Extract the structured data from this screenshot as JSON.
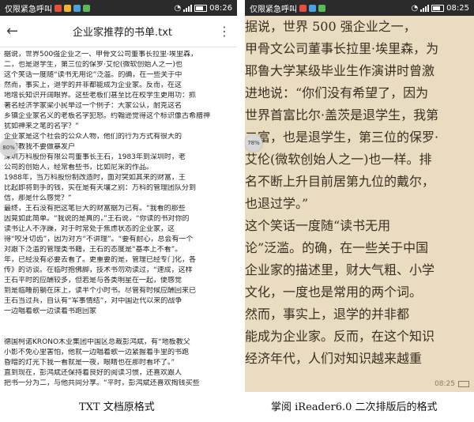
{
  "left": {
    "status": {
      "carrier": "仅限紧急呼叫",
      "time": "08:26"
    },
    "title": "企业家推荐的书单.txt",
    "progress": "80%",
    "lines": [
      "据说，世界500强企业之一、甲骨文公司董事长拉里·埃里森，",
      "二，也是退学生，第三位的保罗·艾伦(微软创始人之一)也",
      "    这个笑话一度随“读书无用论”泛滥。的确，在一些关于中",
      "    然而，事实上，退学的并非都能成为企业家。反而，在这",
      "地增长知识开阔眼界。这些老板们甚至比在校学生更用功：抓",
      "    著名经济学家梁小民举过一个例子：大家公认，耐克这名",
      "乡镇企业家名义的老板名字犯怒。约翰逊觉得这个标识像古希腊神",
      "犹如神来之笔的名字？”",
      "    企业家是这个社会的公众人物，他们的行为方式有很大的",
      "    书籍教我不要做暴发户",
      "    深圳万科股份有限公司董事长王石，1983年到深圳时，老",
      "公司的创始人，经常看些书，比如尼采的作品。",
      "    1988年，当万科股份制改造时，面对突如其来的财富，王",
      "比起即将到手的钱，实在是有天壤之别：万科的管理团队分到",
      "信，那是什么感觉？”",
      "    最终，王石没有把这笔巨大的财富据为己有。“我看的那些",
      "因竟如此简单。“我说的是真的，”王石说，“你读的书对你的",
      "    读书让人不浮躁，对于时常处于焦虑状态的企业家，这",
      "得“咬牙切齿”，因为对方“不讲理”。“要有耐心，总会有一个",
      "对跟下泛滥的管理类书籍，王石的态度是“基本上不看”。",
      "年，已经没有必要去看了。更重要的是，管理已经专门化，各",
      "传》的访谈。在临时抱佛脚，技术书勿劝读过，“速成，这样",
      "    王石平时的应酬较多，但若是与各类明星在一起，便感觉",
      "到是临睡前躺在床上，读半个小时书。尽管有时候应酬回来已",
      "    王石当过兵，自认有“军事情结”，对中国近代以来的战争",
      "    一边唱着歌一边读着书跑回家",
      "",
      "",
      "    德国柯诺KRONO木业集团中国区总裁彭鸿斌，有“地板教父",
      "小影不免心里害怕，他就一边唱着歌一边紧握着手里的书跑",
      "昏暗的灯光下我一看就是一夜，眼睛也在那时看坏了。”",
      "    直到现在，彭鸿斌还保持着良好的阅读习惯，还喜欢跟人",
      "把书一分为二，与他共同分享。“平时，彭鸿斌还喜欢掏钱买些"
    ]
  },
  "right": {
    "status": {
      "carrier": "仅限紧急呼叫",
      "time": "08:25"
    },
    "progress": "78%",
    "lines": [
      "    据说，世界 500 强企业之一，",
      "甲骨文公司董事长拉里·埃里森，为",
      "耶鲁大学某级毕业生作演讲时曾激",
      "进地说：“你们没有希望了，因为",
      "世界首富比尔·盖茨是退学生，我第",
      "二富，也是退学生，第三位的保罗·",
      "艾伦(微软创始人之一)也一样。排",
      "名不断上升目前居第九位的戴尔，",
      "也退过学。”",
      "    这个笑话一度随“读书无用",
      "论”泛滥。的确，在一些关于中国",
      "企业家的描述里，财大气粗、小学",
      "文化，一度也是常用的两个词。",
      "    然而，事实上，退学的并非都",
      "能成为企业家。反而，在这个知识",
      "经济年代，人们对知识越来越重"
    ],
    "footer_time": "08:25"
  },
  "captions": {
    "left": "TXT 文档原格式",
    "right": "掌阅 iReader6.0 二次排版后的格式"
  },
  "colors": {
    "reader_bg": "#e9dcc0",
    "status_bg": "#2b2b2b"
  }
}
